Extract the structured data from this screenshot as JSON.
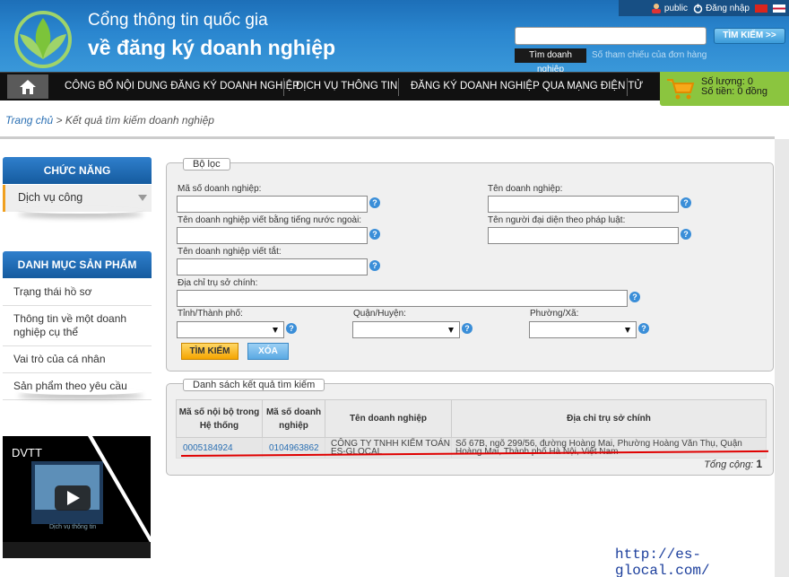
{
  "header": {
    "title_line1": "Cổng thông tin quốc gia",
    "title_line2": "về đăng ký doanh nghiệp",
    "user": "public",
    "login": "Đăng nhập",
    "search": {
      "placeholder": "",
      "button": "TÌM KIẾM >>",
      "tab_business": "Tìm doanh nghiệp",
      "tab_reference": "Số tham chiếu của đơn hàng"
    }
  },
  "nav": {
    "items": [
      "CÔNG BỐ NỘI DUNG ĐĂNG KÝ DOANH NGHIỆP",
      "DỊCH VỤ THÔNG TIN",
      "ĐĂNG KÝ DOANH NGHIỆP QUA MẠNG ĐIỆN TỬ"
    ]
  },
  "cart": {
    "quantity": "Số lượng: 0",
    "amount": "Số tiền: 0 đồng"
  },
  "breadcrumb": {
    "home": "Trang chủ",
    "current": " > Kết quả tìm kiếm doanh nghiệp"
  },
  "sidebar": {
    "functions_title": "CHỨC NĂNG",
    "service": "Dịch vụ công",
    "catalog_title": "DANH MỤC SẢN PHẨM",
    "catalog_items": [
      "Trạng thái hồ sơ",
      "Thông tin về một doanh nghiệp cụ thể",
      "Vai trò của cá nhân",
      "Sản phẩm theo yêu cầu"
    ],
    "video_title": "DVTT",
    "video_caption": "Dịch vụ thông tin"
  },
  "filter": {
    "legend": "Bộ lọc",
    "labels": {
      "tax_code": "Mã số doanh nghiệp:",
      "name": "Tên doanh nghiệp:",
      "foreign_name": "Tên doanh nghiệp viết bằng tiếng nước ngoài:",
      "representative": "Tên người đại diện theo pháp luật:",
      "short_name": "Tên doanh nghiệp viết tắt:",
      "address": "Địa chỉ trụ sở chính:",
      "province": "Tỉnh/Thành phố:",
      "district": "Quận/Huyện:",
      "ward": "Phường/Xã:"
    },
    "search_button": "TÌM KIẾM",
    "clear_button": "XÓA"
  },
  "results": {
    "legend": "Danh sách kết quả tìm kiếm",
    "headers": [
      "Mã số nội bộ trong Hệ thống",
      "Mã số doanh nghiệp",
      "Tên doanh nghiệp",
      "Địa chỉ trụ sở chính"
    ],
    "rows": [
      {
        "internal_id": "0005184924",
        "tax_code": "0104963862",
        "name": "CÔNG TY TNHH KIỂM TOÁN ES-GLOCAL",
        "address": "Số 67B, ngõ 299/56, đường Hoàng Mai, Phường Hoàng Văn Thụ, Quận Hoàng Mai, Thành phố Hà Nội, Việt Nam"
      }
    ],
    "total_label": "Tổng cộng:",
    "total_value": "1"
  },
  "watermark": "http://es-glocal.com/",
  "colors": {
    "header_blue": "#2a86cf",
    "nav_black": "#111111",
    "cart_green": "#8bc53f",
    "accent_orange": "#f5a500",
    "highlight_red": "#e00000"
  }
}
